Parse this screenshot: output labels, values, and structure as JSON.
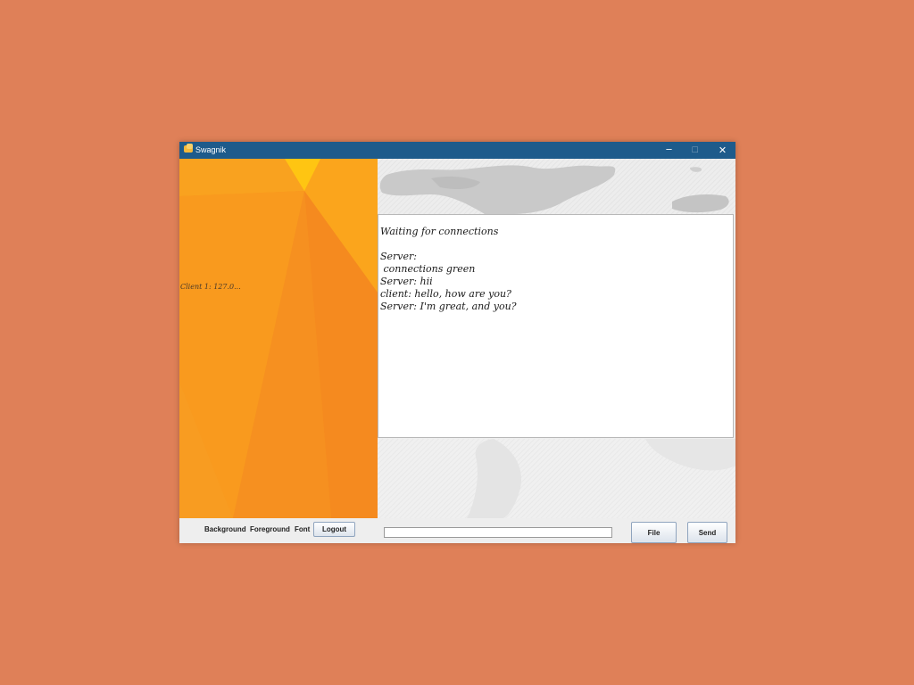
{
  "window": {
    "title": "Swagnik",
    "minimize_glyph": "─",
    "maximize_glyph": "☐",
    "close_glyph": "✕"
  },
  "sidebar": {
    "client_label": "Client 1: 127.0..."
  },
  "chat": {
    "lines": [
      "Waiting for connections",
      "",
      "Server:",
      " connections green",
      "Server: hii",
      "client: hello, how are you?",
      "Server: I'm great, and you?"
    ]
  },
  "bottom_bar": {
    "background_label": "Background",
    "foreground_label": "Foreground",
    "font_label": "Font",
    "logout_label": "Logout",
    "message_value": "",
    "file_label": "File",
    "send_label": "Send"
  },
  "colors": {
    "backdrop": "#DF8058",
    "titlebar": "#1E5B8B",
    "sidebar_orange": "#F7961E",
    "sidebar_yellow": "#FFC512"
  }
}
